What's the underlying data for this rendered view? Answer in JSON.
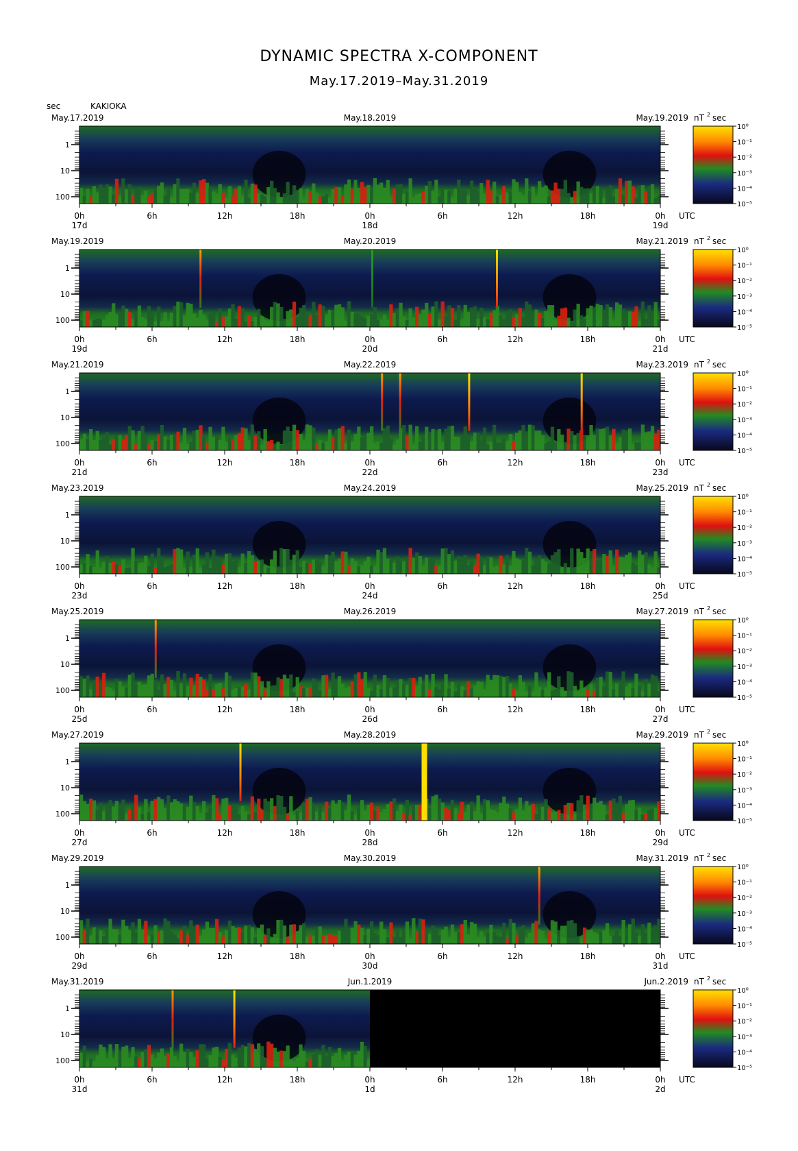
{
  "title": "DYNAMIC SPECTRA X-COMPONENT",
  "subtitle": "May.17.2019–May.31.2019",
  "station": "KAKIOKA",
  "period_unit": "sec",
  "power_unit_label": "nT",
  "power_unit_exp": "2",
  "power_unit_sec": "sec",
  "colorbar": {
    "colors": [
      "#0a0a30",
      "#1a2a80",
      "#1e7a1e",
      "#e02010",
      "#ffd400"
    ],
    "labels": [
      "10⁰",
      "10⁻¹",
      "10⁻²",
      "10⁻³",
      "10⁻⁴",
      "10⁻⁵"
    ]
  },
  "chart_data": {
    "type": "heatmap",
    "title": "DYNAMIC SPECTRA X-COMPONENT",
    "subtitle": "May.17.2019–May.31.2019",
    "ylabel": "sec",
    "y_ticks": [
      "1",
      "10",
      "100"
    ],
    "x_tick_labels": [
      "0h",
      "6h",
      "12h",
      "18h",
      "0h",
      "6h",
      "12h",
      "18h",
      "0h"
    ],
    "x_unit": "UTC",
    "color_scale_label": "nT² sec",
    "panels": [
      {
        "left_date": "May.17.2019",
        "mid_date": "May.18.2019",
        "right_date": "May.19.2019",
        "days": [
          "17d",
          "18d",
          "19d"
        ],
        "spikes": [],
        "blackout_from_hour": null
      },
      {
        "left_date": "May.19.2019",
        "mid_date": "May.20.2019",
        "right_date": "May.21.2019",
        "days": [
          "19d",
          "20d",
          "21d"
        ],
        "spikes": [
          {
            "hour": 10,
            "intensity": "red"
          },
          {
            "hour": 24.2,
            "intensity": "green"
          },
          {
            "hour": 34.5,
            "intensity": "yellow"
          }
        ],
        "blackout_from_hour": null
      },
      {
        "left_date": "May.21.2019",
        "mid_date": "May.22.2019",
        "right_date": "May.23.2019",
        "days": [
          "21d",
          "22d",
          "23d"
        ],
        "spikes": [
          {
            "hour": 25,
            "intensity": "red"
          },
          {
            "hour": 26.5,
            "intensity": "red"
          },
          {
            "hour": 32.2,
            "intensity": "yellow"
          },
          {
            "hour": 41.5,
            "intensity": "yellow"
          }
        ],
        "blackout_from_hour": null
      },
      {
        "left_date": "May.23.2019",
        "mid_date": "May.24.2019",
        "right_date": "May.25.2019",
        "days": [
          "23d",
          "24d",
          "25d"
        ],
        "spikes": [],
        "blackout_from_hour": null
      },
      {
        "left_date": "May.25.2019",
        "mid_date": "May.26.2019",
        "right_date": "May.27.2019",
        "days": [
          "25d",
          "26d",
          "27d"
        ],
        "spikes": [
          {
            "hour": 6.3,
            "intensity": "red"
          }
        ],
        "blackout_from_hour": null
      },
      {
        "left_date": "May.27.2019",
        "mid_date": "May.28.2019",
        "right_date": "May.29.2019",
        "days": [
          "27d",
          "28d",
          "29d"
        ],
        "spikes": [
          {
            "hour": 13.3,
            "intensity": "yellow"
          },
          {
            "hour": 28.5,
            "intensity": "yellow-band"
          }
        ],
        "blackout_from_hour": null
      },
      {
        "left_date": "May.29.2019",
        "mid_date": "May.30.2019",
        "right_date": "May.31.2019",
        "days": [
          "29d",
          "30d",
          "31d"
        ],
        "spikes": [
          {
            "hour": 38,
            "intensity": "red"
          }
        ],
        "blackout_from_hour": null
      },
      {
        "left_date": "May.31.2019",
        "mid_date": "Jun.1.2019",
        "right_date": "Jun.2.2019",
        "days": [
          "31d",
          "1d",
          "2d"
        ],
        "spikes": [
          {
            "hour": 7.7,
            "intensity": "red"
          },
          {
            "hour": 12.8,
            "intensity": "yellow"
          }
        ],
        "blackout_from_hour": 24
      }
    ]
  }
}
